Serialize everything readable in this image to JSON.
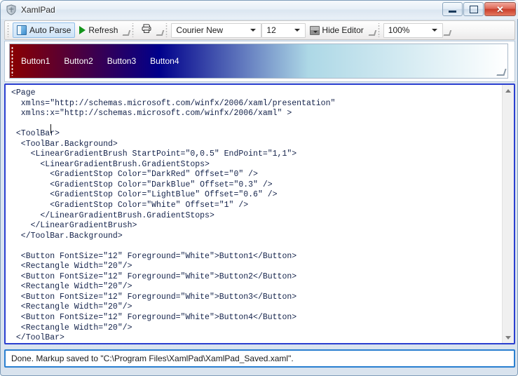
{
  "window": {
    "title": "XamlPad",
    "icon": "shield-icon",
    "controls": {
      "minimize": "Minimize",
      "maximize": "Maximize",
      "close": "✕"
    }
  },
  "toolbar": {
    "auto_parse_label": "Auto Parse",
    "auto_parse_checked": true,
    "refresh_label": "Refresh",
    "print_label": "Print",
    "font_family_value": "Courier New",
    "font_size_value": "12",
    "hide_editor_label": "Hide Editor",
    "zoom_value": "100%"
  },
  "preview": {
    "buttons": [
      "Button1",
      "Button2",
      "Button3",
      "Button4"
    ],
    "gradient": {
      "start_point": "0,0.5",
      "end_point": "1,1",
      "stops": [
        {
          "color": "DarkRed",
          "hex": "#8b0000",
          "offset": "0"
        },
        {
          "color": "DarkBlue",
          "hex": "#00008b",
          "offset": "0.3"
        },
        {
          "color": "LightBlue",
          "hex": "#add8e6",
          "offset": "0.6"
        },
        {
          "color": "White",
          "hex": "#ffffff",
          "offset": "1"
        }
      ]
    }
  },
  "editor": {
    "code": "<Page\n  xmlns=\"http://schemas.microsoft.com/winfx/2006/xaml/presentation\"\n  xmlns:x=\"http://schemas.microsoft.com/winfx/2006/xaml\" >\n\n <ToolBar>\n  <ToolBar.Background>\n    <LinearGradientBrush StartPoint=\"0,0.5\" EndPoint=\"1,1\">\n      <LinearGradientBrush.GradientStops>\n        <GradientStop Color=\"DarkRed\" Offset=\"0\" />\n        <GradientStop Color=\"DarkBlue\" Offset=\"0.3\" />\n        <GradientStop Color=\"LightBlue\" Offset=\"0.6\" />\n        <GradientStop Color=\"White\" Offset=\"1\" />\n      </LinearGradientBrush.GradientStops>\n    </LinearGradientBrush>\n  </ToolBar.Background>\n\n  <Button FontSize=\"12\" Foreground=\"White\">Button1</Button>\n  <Rectangle Width=\"20\"/>\n  <Button FontSize=\"12\" Foreground=\"White\">Button2</Button>\n  <Rectangle Width=\"20\"/>\n  <Button FontSize=\"12\" Foreground=\"White\">Button3</Button>\n  <Rectangle Width=\"20\"/>\n  <Button FontSize=\"12\" Foreground=\"White\">Button4</Button>\n  <Rectangle Width=\"20\"/>\n </ToolBar>\n\n</Page>"
  },
  "statusbar": {
    "message": "Done. Markup saved to \"C:\\Program Files\\XamlPad\\XamlPad_Saved.xaml\"."
  },
  "colors": {
    "editor_border": "#2a3fd0",
    "status_border": "#2a7fd0",
    "code_text": "#13224a"
  }
}
